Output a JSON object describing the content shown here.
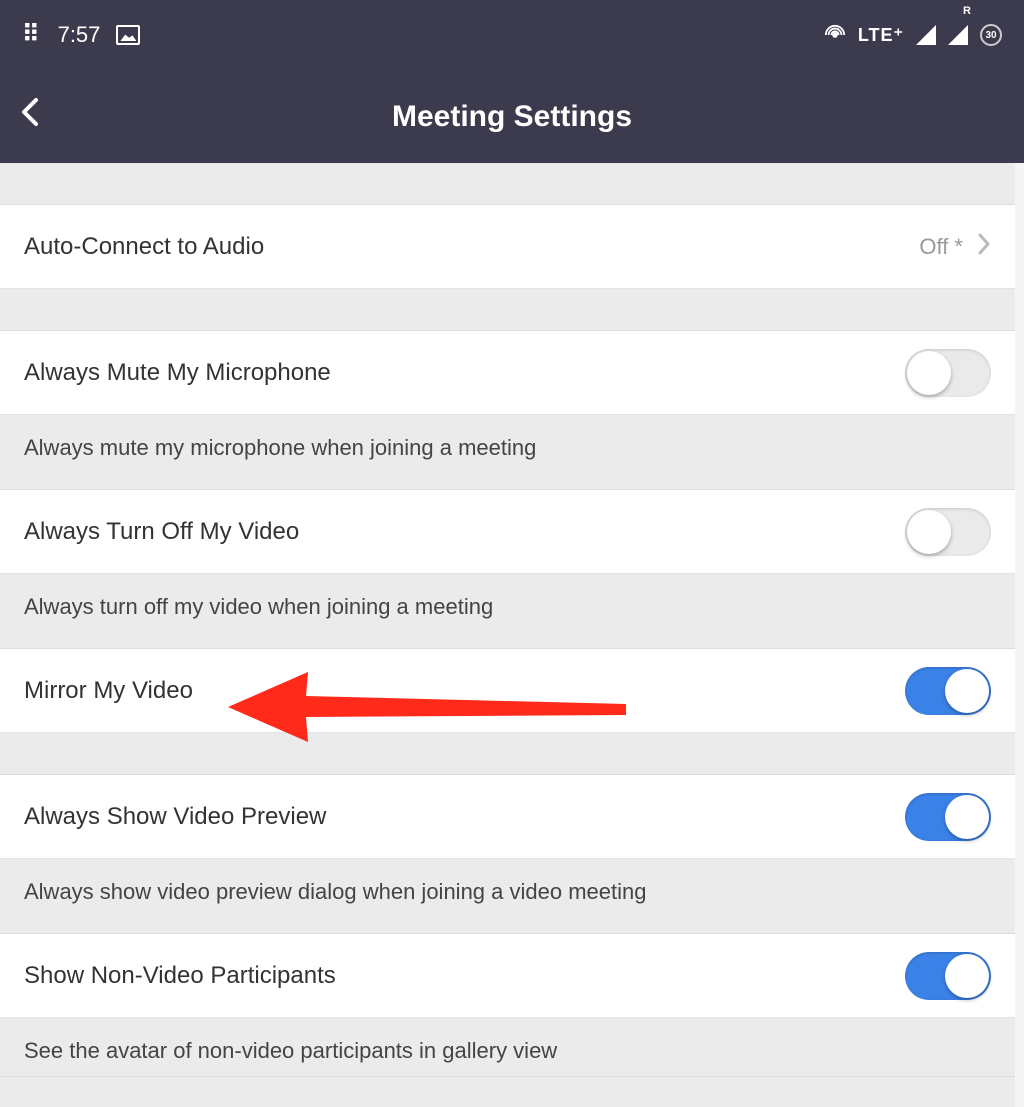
{
  "statusBar": {
    "time": "7:57",
    "network": "LTE⁺",
    "badge": "30"
  },
  "header": {
    "title": "Meeting Settings"
  },
  "rows": {
    "autoConnect": {
      "label": "Auto-Connect to Audio",
      "value": "Off *"
    },
    "muteMic": {
      "label": "Always Mute My Microphone",
      "desc": "Always mute my microphone when joining a meeting",
      "on": false
    },
    "turnOffVideo": {
      "label": "Always Turn Off My Video",
      "desc": "Always turn off my video when joining a meeting",
      "on": false
    },
    "mirrorVideo": {
      "label": "Mirror My Video",
      "on": true
    },
    "videoPreview": {
      "label": "Always Show Video Preview",
      "desc": "Always show video preview dialog when joining a video meeting",
      "on": true
    },
    "nonVideo": {
      "label": "Show Non-Video Participants",
      "desc": "See the avatar of non-video participants in gallery view",
      "on": true
    }
  }
}
